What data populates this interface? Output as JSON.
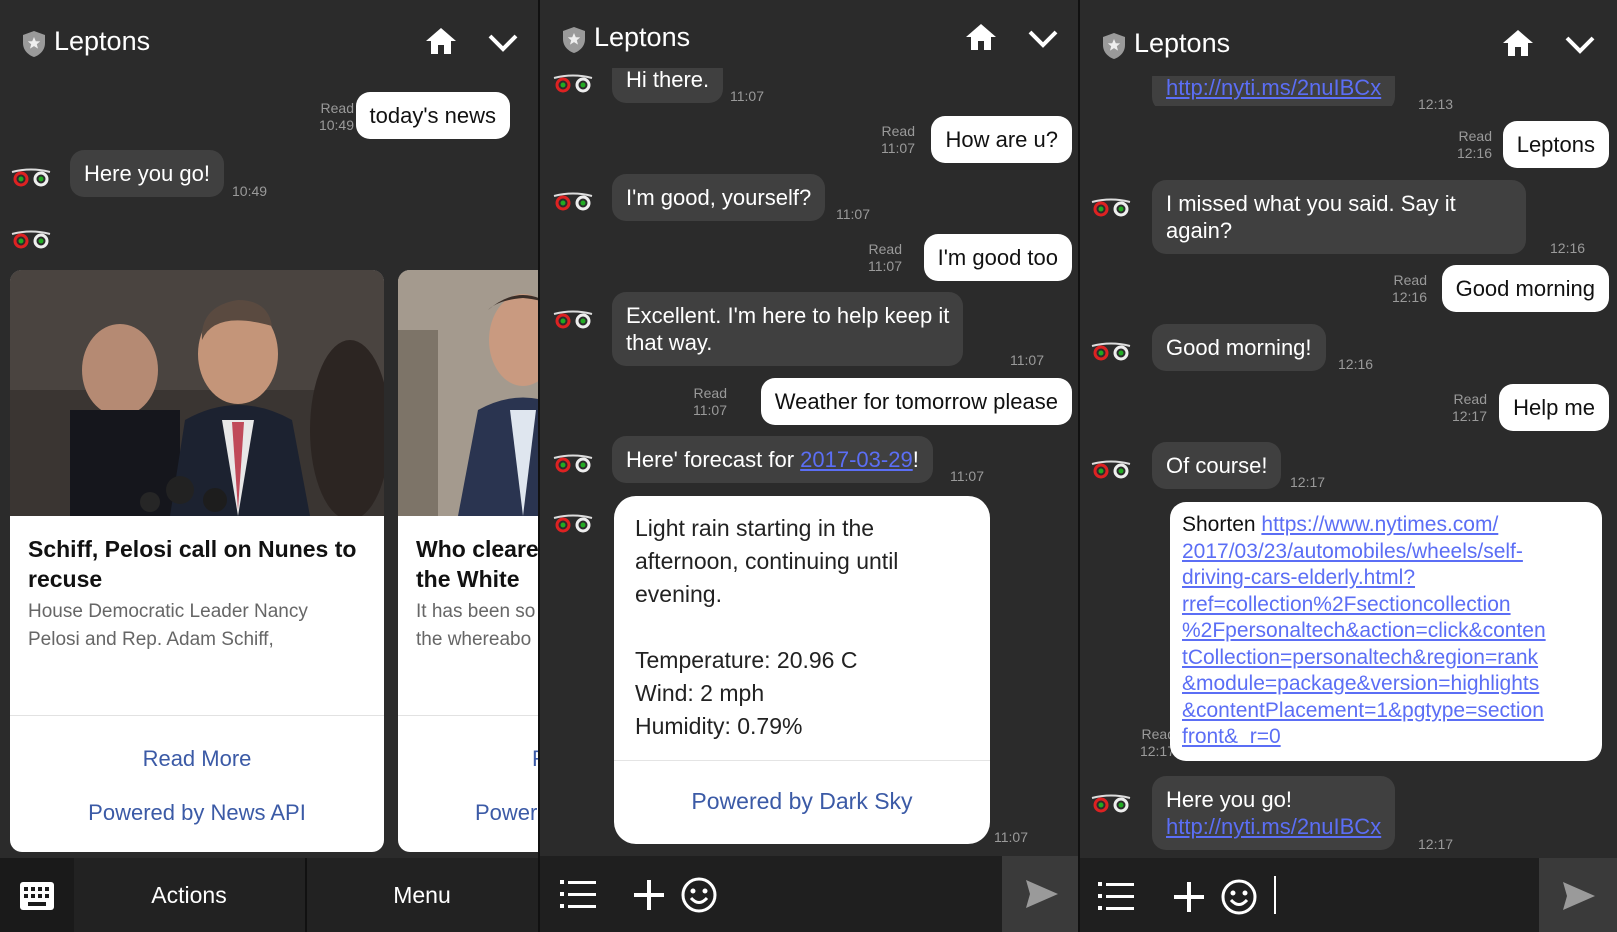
{
  "app": {
    "title": "Leptons"
  },
  "panel1": {
    "msg_user_1": {
      "text": "today's news",
      "read": "Read",
      "time": "10:49"
    },
    "msg_bot_1": {
      "text": "Here you go!",
      "time": "10:49"
    },
    "cards": [
      {
        "headline_line1": "Schiff, Pelosi call on Nunes to",
        "headline_line2": "recuse",
        "desc_line1": "House Democratic Leader Nancy",
        "desc_line2": "Pelosi and Rep. Adam Schiff,",
        "read_more": "Read More",
        "powered": "Powered by News API"
      },
      {
        "headline_line1": "Who cleared",
        "headline_line2": "the White",
        "desc_line1": "It has been so",
        "desc_line2": "the whereabo",
        "read_more": "R",
        "powered": "Power"
      }
    ],
    "footer": {
      "actions": "Actions",
      "menu": "Menu"
    }
  },
  "panel2": {
    "m1": {
      "text": "Hi there.",
      "time": "11:07"
    },
    "m2": {
      "text": "How are u?",
      "read": "Read",
      "time": "11:07"
    },
    "m3": {
      "text": "I'm good, yourself?",
      "time": "11:07"
    },
    "m4": {
      "text": "I'm good too",
      "read": "Read",
      "time": "11:07"
    },
    "m5": {
      "line1": "Excellent. I'm here to help keep it",
      "line2": "that way.",
      "time": "11:07"
    },
    "m6": {
      "text": "Weather for tomorrow please",
      "read": "Read",
      "time": "11:07"
    },
    "m7": {
      "prefix": "Here' forecast for ",
      "link": "2017-03-29",
      "suffix": "!",
      "time": "11:07"
    },
    "weather": {
      "l1": "Light rain starting in the",
      "l2": "afternoon, continuing until",
      "l3": "evening.",
      "temp": "Temperature: 20.96 C",
      "wind": "Wind: 2 mph",
      "humidity": "Humidity: 0.79%",
      "powered": "Powered by Dark Sky",
      "time": "11:07"
    }
  },
  "panel3": {
    "m0": {
      "link": "http://nyti.ms/2nuIBCx",
      "time": "12:13"
    },
    "m1": {
      "text": "Leptons",
      "read": "Read",
      "time": "12:16"
    },
    "m2": {
      "line1": "I missed what you said. Say it",
      "line2": "again?",
      "time": "12:16"
    },
    "m3": {
      "text": "Good morning",
      "read": "Read",
      "time": "12:16"
    },
    "m4": {
      "text": "Good morning!",
      "time": "12:16"
    },
    "m5": {
      "text": "Help me",
      "read": "Read",
      "time": "12:17"
    },
    "m6": {
      "text": "Of course!",
      "time": "12:17"
    },
    "m7": {
      "prefix": "Shorten ",
      "lines": [
        "https://www.nytimes.com/",
        "2017/03/23/automobiles/wheels/self-",
        "driving-cars-elderly.html?",
        "rref=collection%2Fsectioncollection",
        "%2Fpersonaltech&action=click&conten",
        "tCollection=personaltech&region=rank",
        "&module=package&version=highlights",
        "&contentPlacement=1&pgtype=section",
        "front&_r=0"
      ],
      "read": "Read",
      "time": "12:17"
    },
    "m8": {
      "text": "Here you go!",
      "link": "http://nyti.ms/2nuIBCx",
      "time": "12:17"
    }
  }
}
